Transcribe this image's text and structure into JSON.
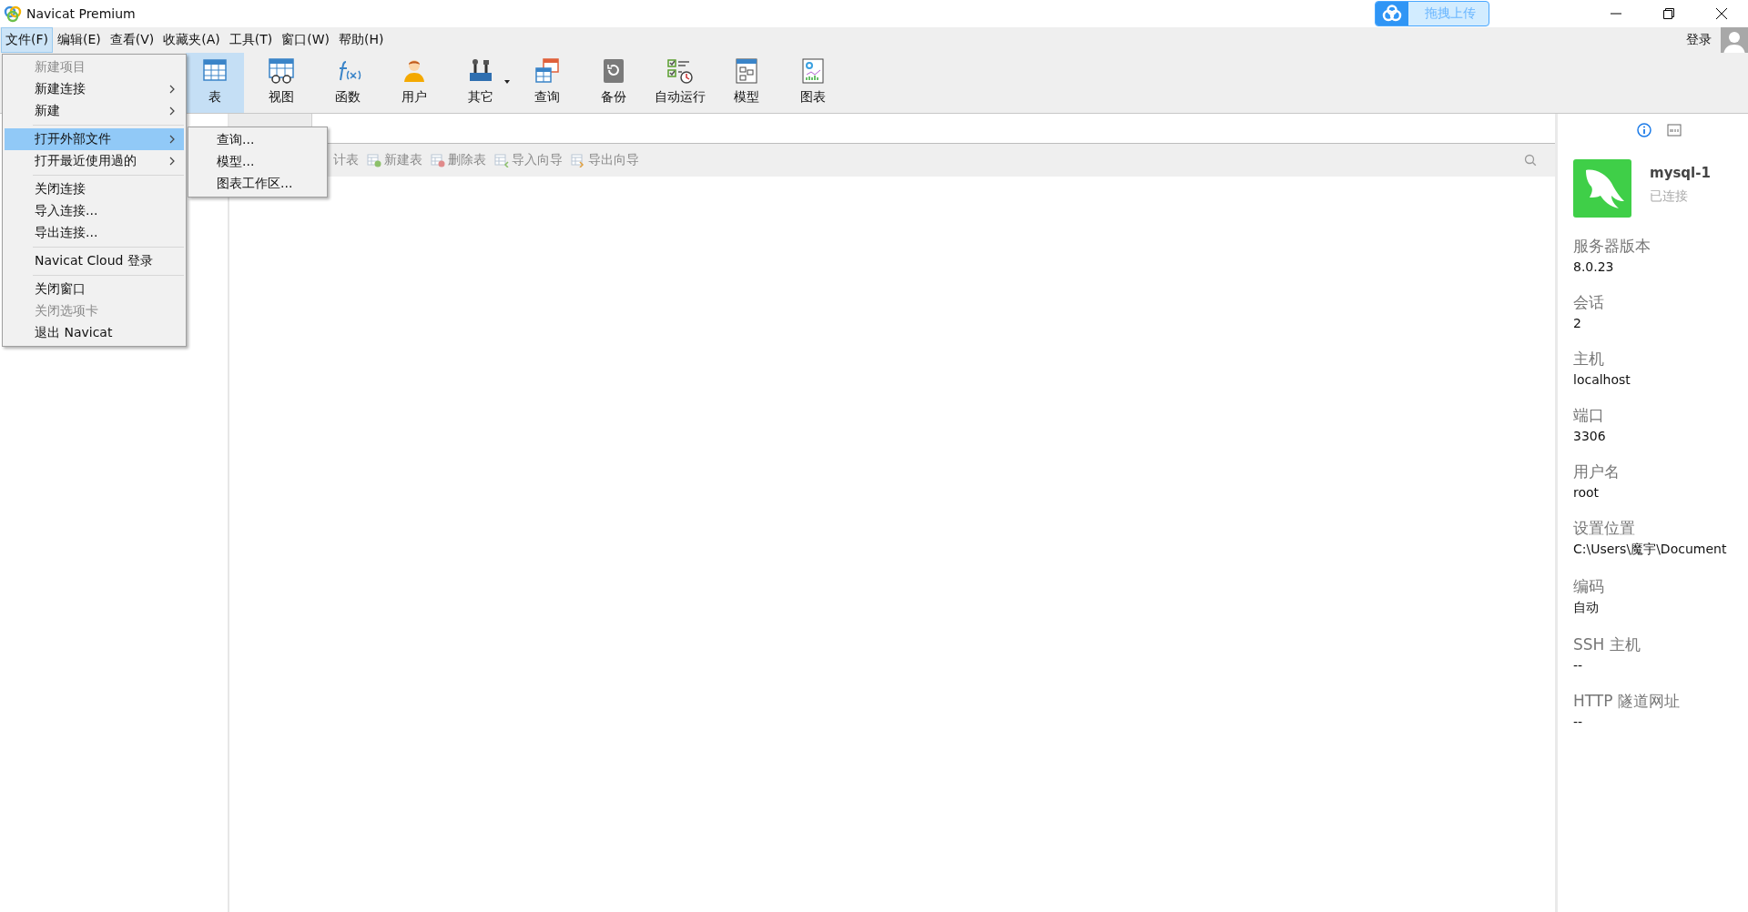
{
  "window": {
    "title": "Navicat Premium"
  },
  "upload_widget": {
    "label": "拖拽上传"
  },
  "menu_bar": [
    {
      "label": "文件(F)",
      "selected": true
    },
    {
      "label": "编辑(E)",
      "selected": false
    },
    {
      "label": "查看(V)",
      "selected": false
    },
    {
      "label": "收藏夹(A)",
      "selected": false
    },
    {
      "label": "工具(T)",
      "selected": false
    },
    {
      "label": "窗口(W)",
      "selected": false
    },
    {
      "label": "帮助(H)",
      "selected": false
    }
  ],
  "login": {
    "label": "登录"
  },
  "toolbar": [
    {
      "label": "表",
      "selected": true,
      "dropdown": false
    },
    {
      "label": "视图",
      "selected": false,
      "dropdown": false
    },
    {
      "label": "函数",
      "selected": false,
      "dropdown": false
    },
    {
      "label": "用户",
      "selected": false,
      "dropdown": false
    },
    {
      "label": "其它",
      "selected": false,
      "dropdown": true
    },
    {
      "label": "查询",
      "selected": false,
      "dropdown": false
    },
    {
      "label": "备份",
      "selected": false,
      "dropdown": false
    },
    {
      "label": "自动运行",
      "selected": false,
      "dropdown": false
    },
    {
      "label": "模型",
      "selected": false,
      "dropdown": false
    },
    {
      "label": "图表",
      "selected": false,
      "dropdown": false
    }
  ],
  "object_toolbar": [
    {
      "label": "计表"
    },
    {
      "label": "新建表"
    },
    {
      "label": "删除表"
    },
    {
      "label": "导入向导"
    },
    {
      "label": "导出向导"
    }
  ],
  "file_menu": [
    {
      "kind": "item",
      "label": "新建项目",
      "disabled": true,
      "submenu": false,
      "selected": false
    },
    {
      "kind": "item",
      "label": "新建连接",
      "disabled": false,
      "submenu": true,
      "selected": false
    },
    {
      "kind": "item",
      "label": "新建",
      "disabled": false,
      "submenu": true,
      "selected": false
    },
    {
      "kind": "separator"
    },
    {
      "kind": "item",
      "label": "打开外部文件",
      "disabled": false,
      "submenu": true,
      "selected": true
    },
    {
      "kind": "item",
      "label": "打开最近使用過的",
      "disabled": false,
      "submenu": true,
      "selected": false
    },
    {
      "kind": "separator"
    },
    {
      "kind": "item",
      "label": "关闭连接",
      "disabled": false,
      "submenu": false,
      "selected": false
    },
    {
      "kind": "item",
      "label": "导入连接...",
      "disabled": false,
      "submenu": false,
      "selected": false
    },
    {
      "kind": "item",
      "label": "导出连接...",
      "disabled": false,
      "submenu": false,
      "selected": false
    },
    {
      "kind": "separator"
    },
    {
      "kind": "item",
      "label": "Navicat Cloud 登录",
      "disabled": false,
      "submenu": false,
      "selected": false
    },
    {
      "kind": "separator"
    },
    {
      "kind": "item",
      "label": "关闭窗口",
      "disabled": false,
      "submenu": false,
      "selected": false
    },
    {
      "kind": "item",
      "label": "关闭选项卡",
      "disabled": true,
      "submenu": false,
      "selected": false
    },
    {
      "kind": "item",
      "label": "退出 Navicat",
      "disabled": false,
      "submenu": false,
      "selected": false
    }
  ],
  "submenu": [
    "查询...",
    "模型...",
    "图表工作区..."
  ],
  "connection": {
    "name": "mysql-1",
    "status": "已连接"
  },
  "properties": [
    {
      "label": "服务器版本",
      "value": "8.0.23"
    },
    {
      "label": "会话",
      "value": "2"
    },
    {
      "label": "主机",
      "value": "localhost"
    },
    {
      "label": "端口",
      "value": "3306"
    },
    {
      "label": "用户名",
      "value": "root"
    },
    {
      "label": "设置位置",
      "value": "C:\\Users\\魔宇\\Document"
    },
    {
      "label": "编码",
      "value": "自动"
    },
    {
      "label": "SSH 主机",
      "value": "--"
    },
    {
      "label": "HTTP 隧道网址",
      "value": "--"
    }
  ]
}
